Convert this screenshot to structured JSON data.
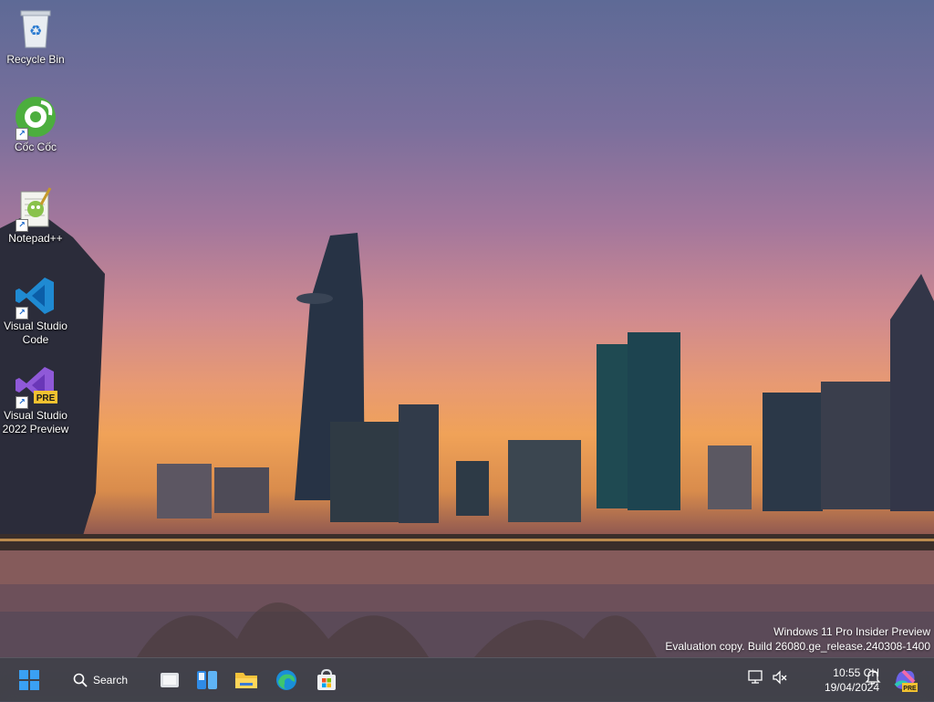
{
  "desktop": {
    "icons": [
      {
        "label": "Recycle Bin",
        "icon": "recycle-bin-icon"
      },
      {
        "label": "Cốc Cốc",
        "icon": "coccoc-icon"
      },
      {
        "label": "Notepad++",
        "icon": "notepadplusplus-icon"
      },
      {
        "label": "Visual Studio Code",
        "icon": "vscode-icon"
      },
      {
        "label": "Visual Studio 2022 Preview",
        "icon": "visual-studio-preview-icon",
        "badge": "PRE"
      }
    ]
  },
  "watermark": {
    "line1": "Windows 11 Pro Insider Preview",
    "line2": "Evaluation copy. Build 26080.ge_release.240308-1400"
  },
  "taskbar": {
    "search_label": "Search",
    "apps": [
      "start-icon",
      "task-view-icon",
      "widgets-icon",
      "file-explorer-icon",
      "edge-icon",
      "store-icon"
    ],
    "clock": {
      "time": "10:55 CH",
      "date": "19/04/2024"
    },
    "tray_icons": [
      "network-icon",
      "volume-muted-icon",
      "notification-bell-icon",
      "copilot-icon"
    ],
    "copilot_badge": "PRE"
  },
  "colors": {
    "taskbar_bg": "#46484f",
    "start_blue": "#3aa0f3",
    "folder_yellow": "#f5c33b",
    "vscode_blue": "#1f8ad2",
    "vs_purple": "#8f59d8"
  }
}
